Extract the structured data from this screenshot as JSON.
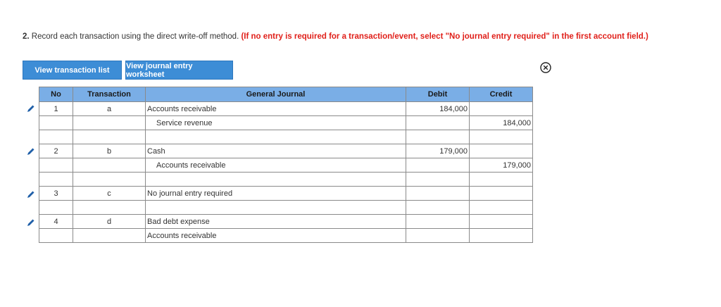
{
  "instructions": {
    "number": "2.",
    "text": "Record each transaction using the direct write-off method.",
    "note": "(If no entry is required for a transaction/event, select \"No journal entry required\" in the first account field.)"
  },
  "buttons": {
    "transaction_list": "View transaction list",
    "journal_worksheet": "View journal entry worksheet"
  },
  "table": {
    "headers": {
      "no": "No",
      "transaction": "Transaction",
      "general_journal": "General Journal",
      "debit": "Debit",
      "credit": "Credit"
    },
    "rows": [
      {
        "no": "1",
        "transaction": "a",
        "account": "Accounts receivable",
        "debit": "184,000",
        "credit": ""
      },
      {
        "no": "",
        "transaction": "",
        "account": "Service revenue",
        "debit": "",
        "credit": "184,000"
      },
      {
        "no": "",
        "transaction": "",
        "account": "",
        "debit": "",
        "credit": ""
      },
      {
        "no": "2",
        "transaction": "b",
        "account": "Cash",
        "debit": "179,000",
        "credit": ""
      },
      {
        "no": "",
        "transaction": "",
        "account": "Accounts receivable",
        "debit": "",
        "credit": "179,000"
      },
      {
        "no": "",
        "transaction": "",
        "account": "",
        "debit": "",
        "credit": ""
      },
      {
        "no": "3",
        "transaction": "c",
        "account": "No journal entry required",
        "debit": "",
        "credit": ""
      },
      {
        "no": "",
        "transaction": "",
        "account": "",
        "debit": "",
        "credit": ""
      },
      {
        "no": "4",
        "transaction": "d",
        "account": "Bad debt expense",
        "debit": "",
        "credit": ""
      },
      {
        "no": "",
        "transaction": "",
        "account": "Accounts receivable",
        "debit": "",
        "credit": ""
      }
    ]
  },
  "icons": {
    "edit": "pencil-icon",
    "close": "close-circle-icon"
  }
}
